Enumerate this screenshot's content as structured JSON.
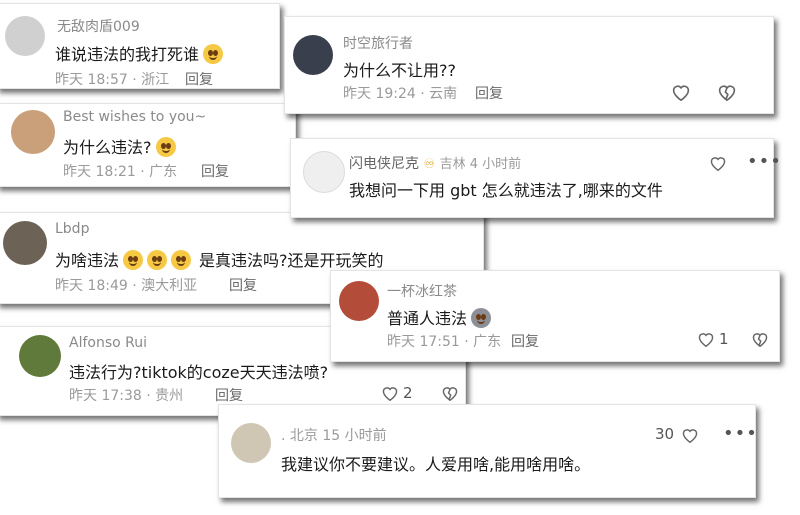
{
  "comments": [
    {
      "name": "无敌肉盾009",
      "text": "谁说违法的我打死谁",
      "meta": "昨天 18:57 · 浙江",
      "reply": "回复",
      "avatar_color": "#cfcfcf",
      "emoji": "thinking-emoji"
    },
    {
      "name": "Best wishes to you~",
      "text": "为什么违法?",
      "meta": "昨天 18:21 · 广东",
      "reply": "回复",
      "avatar_color": "#c9a079",
      "emoji": "flushed-emoji"
    },
    {
      "name": "Lbdp",
      "text": "为啥违法",
      "text2": "是真违法吗?还是开玩笑的",
      "meta": "昨天 18:49 · 澳大利亚",
      "reply": "回复",
      "avatar_color": "#6c6256"
    },
    {
      "name": "Alfonso Rui",
      "text": "违法行为?tiktok的coze天天违法喷?",
      "meta": "昨天 17:38 · 贵州",
      "reply": "回复",
      "likes": "2",
      "avatar_color": "#5f7a3a"
    },
    {
      "name": "时空旅行者",
      "text": "为什么不让用??",
      "meta": "昨天 19:24 · 云南",
      "reply": "回复",
      "avatar_color": "#3a3f4d"
    },
    {
      "name": "闪电侠尼克",
      "badge": "吉林 4 小时前",
      "text": "我想问一下用 gbt 怎么就违法了,哪来的文件",
      "avatar_color": "#efefef"
    },
    {
      "name": "一杯冰红茶",
      "text": "普通人违法",
      "meta": "昨天 17:51 · 广东",
      "reply": "回复",
      "likes": "1",
      "avatar_color": "#b44c3a"
    },
    {
      "name": ". 北京 15 小时前",
      "text": "我建议你不要建议。人爱用啥,能用啥用啥。",
      "likes": "30",
      "avatar_color": "#cfc6b4"
    }
  ],
  "icons": {
    "like": "heart-outline-icon",
    "dislike": "broken-heart-icon",
    "more": "more-dots-icon"
  },
  "colors": {
    "accent": "#e1b23a",
    "text": "#1a1a1a",
    "muted": "#8a8a8a"
  }
}
